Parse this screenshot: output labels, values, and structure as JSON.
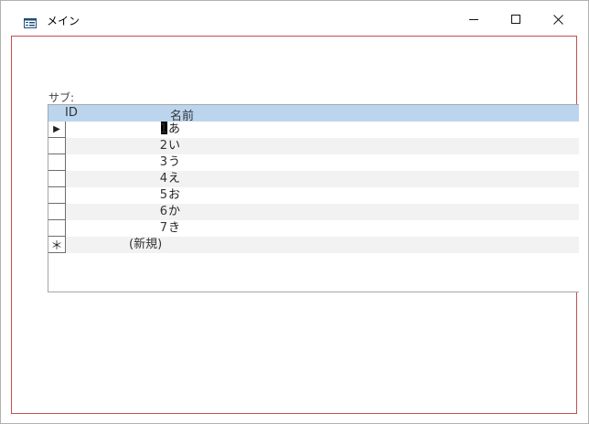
{
  "window": {
    "title": "メイン",
    "icon": "form-icon"
  },
  "subform": {
    "label": "サブ:",
    "columns": [
      "ID",
      "名前"
    ],
    "rows": [
      {
        "id": "1",
        "name": "あ"
      },
      {
        "id": "2",
        "name": "い"
      },
      {
        "id": "3",
        "name": "う"
      },
      {
        "id": "4",
        "name": "え"
      },
      {
        "id": "5",
        "name": "お"
      },
      {
        "id": "6",
        "name": "か"
      },
      {
        "id": "7",
        "name": "き"
      }
    ],
    "new_record_label": "(新規)",
    "current_row_marker": "▶",
    "new_row_marker": "＊"
  },
  "colors": {
    "header_bg": "#bcd5ee",
    "frame_border": "#c0504d",
    "alt_row": "#f2f2f2"
  }
}
